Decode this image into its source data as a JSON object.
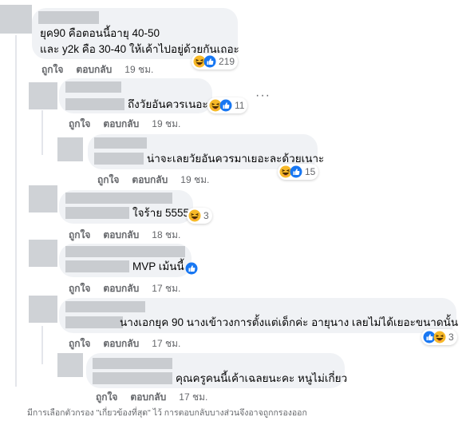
{
  "actions": {
    "like": "ถูกใจ",
    "reply": "ตอบกลับ"
  },
  "comments": [
    {
      "line1": "ยุค90 คือตอนนี้อายุ 40-50",
      "line2": "และ y2k คือ 30-40 ให้เค้าไปอยู่ด้วยกันเถอะ",
      "time": "19 ชม.",
      "reaction_count": "219"
    },
    {
      "text": "ถึงวัยอันควรเนอะ",
      "time": "19 ชม.",
      "reaction_count": "11"
    },
    {
      "text": "น่าจะเลยวัยอันควรมาเยอะละด้วยเนาะ",
      "time": "19 ชม.",
      "reaction_count": "15"
    },
    {
      "text": "ใจร้าย 5555",
      "time": "18 ชม.",
      "reaction_count": "3"
    },
    {
      "text": "MVP เม้นนี้",
      "time": "17 ชม."
    },
    {
      "text": "นางเอกยุค 90 นางเข้าวงการตั้งแต่เด็กค่ะ อายุนาง เลยไม่ได้เยอะขนาดนั้น",
      "time": "17 ชม.",
      "reaction_count": "3"
    },
    {
      "text": "คุณครูคนนี้เค้าเฉลยนะคะ หนูไม่เกี่ยว",
      "time": "17 ชม."
    }
  ],
  "footer": "มีการเลือกตัวกรอง \"เกี่ยวข้องที่สุด\" ไว้ การตอบกลับบางส่วนจึงอาจถูกกรองออก",
  "colors": {
    "like_blue": "#1877f2",
    "haha_yellow": "#f7b928",
    "bubble_bg": "#f0f2f5",
    "meta_gray": "#65676b"
  }
}
